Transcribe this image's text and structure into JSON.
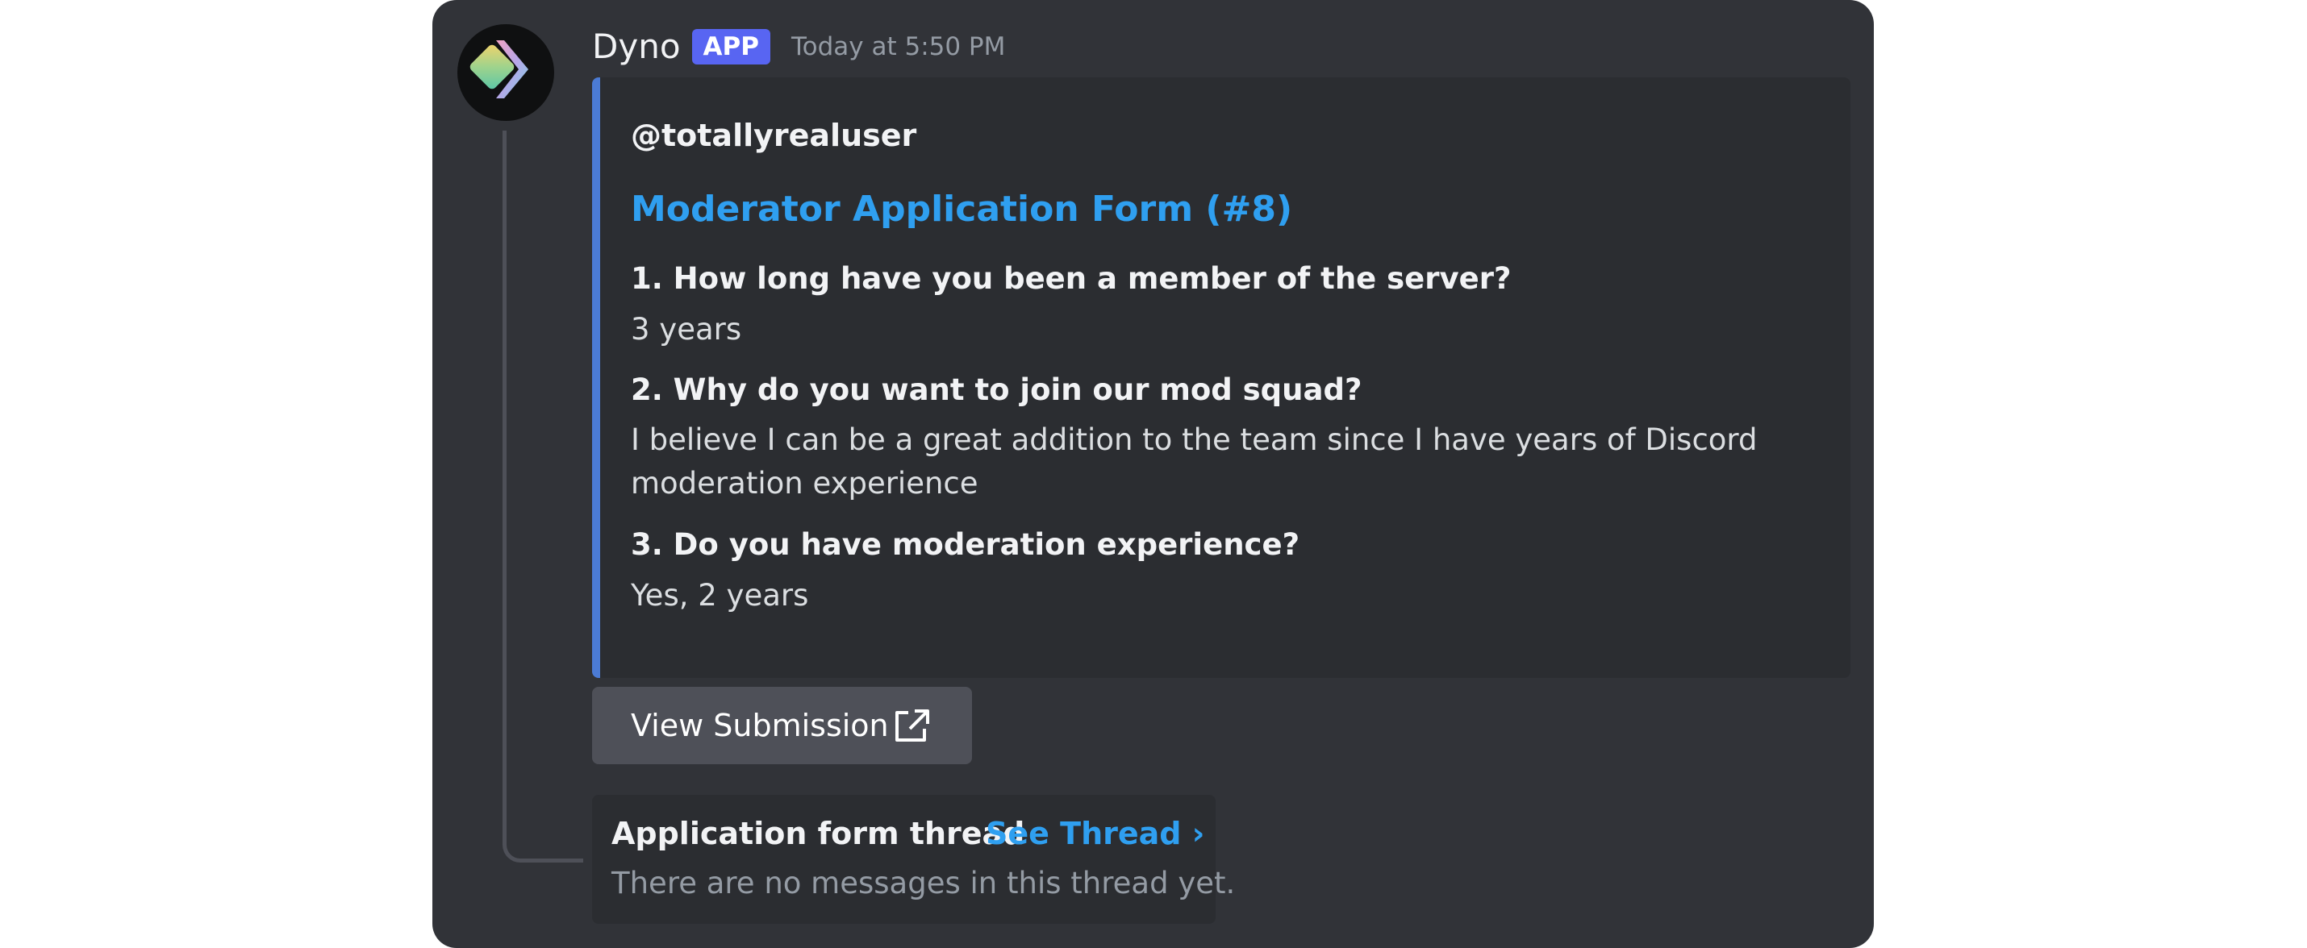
{
  "message": {
    "author": "Dyno",
    "badge": "APP",
    "timestamp": "Today at 5:50 PM",
    "avatar_icon": "dyno-logo-icon"
  },
  "embed": {
    "accent_color": "#4b7bd5",
    "author": "@totallyrealuser",
    "title": "Moderator Application Form (#8)",
    "fields": [
      {
        "name": "1. How long have you been a member of the server?",
        "value": "3 years"
      },
      {
        "name": "2. Why do you want to join our mod squad?",
        "value": "I believe I can be a great addition to the team since I have years of Discord moderation experience"
      },
      {
        "name": "3. Do you have moderation experience?",
        "value": "Yes, 2 years"
      }
    ]
  },
  "button": {
    "label": "View Submission",
    "icon": "external-link-icon"
  },
  "thread": {
    "name": "Application form thread",
    "link": "See Thread ›",
    "empty_text": "There are no messages in this thread yet."
  },
  "colors": {
    "background": "#313338",
    "embed_background": "#2b2d31",
    "badge": "#5865f2",
    "link": "#2f9ff0",
    "button": "#4e5058"
  }
}
